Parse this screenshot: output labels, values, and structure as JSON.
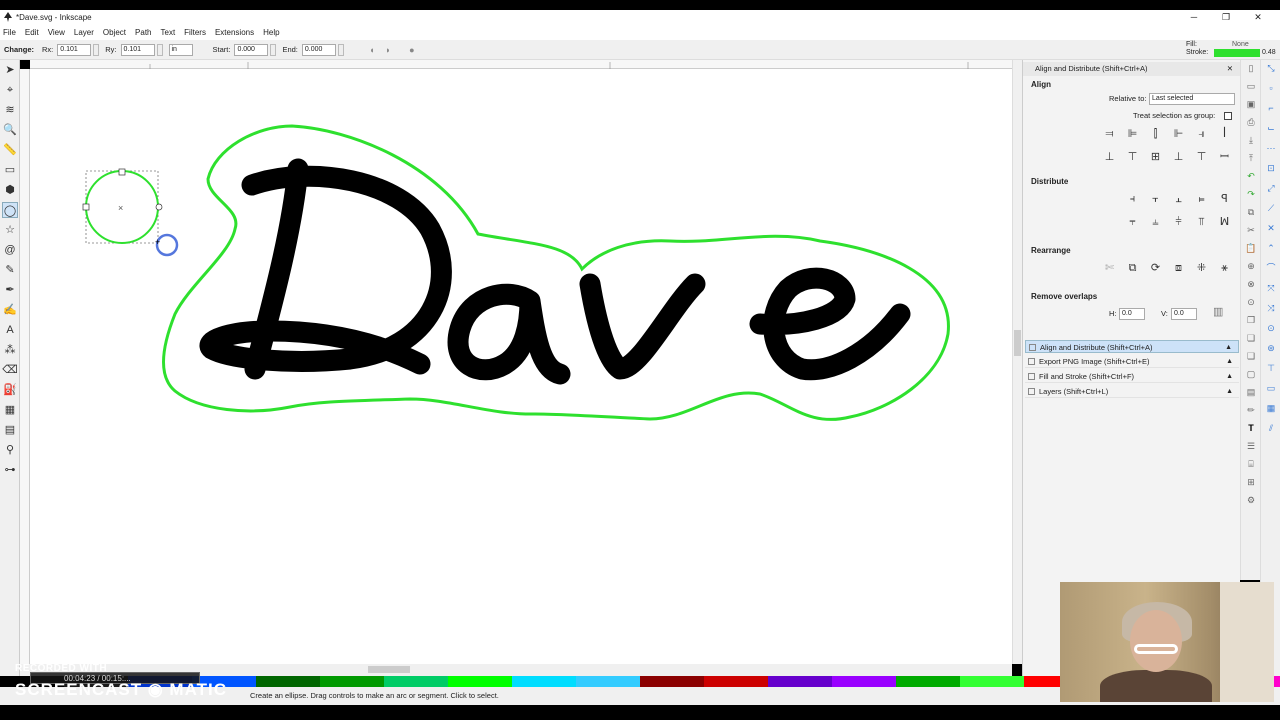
{
  "window": {
    "title": "*Dave.svg - Inkscape",
    "minimize": "─",
    "maximize": "❐",
    "close": "✕"
  },
  "menu": [
    "File",
    "Edit",
    "View",
    "Layer",
    "Object",
    "Path",
    "Text",
    "Filters",
    "Extensions",
    "Help"
  ],
  "tool_controls": {
    "change_label": "Change:",
    "rx_label": "Rx:",
    "rx_value": "0.101",
    "ry_label": "Ry:",
    "ry_value": "0.101",
    "unit": "in",
    "start_label": "Start:",
    "start_value": "0.000",
    "end_label": "End:",
    "end_value": "0.000"
  },
  "fill_stroke": {
    "fill_label": "Fill:",
    "fill_value": "None",
    "stroke_label": "Stroke:",
    "stroke_width": "0.48",
    "stroke_color": "#2ee02e"
  },
  "tools": [
    "selector-tool",
    "node-tool",
    "tweak-tool",
    "zoom-tool",
    "measure-tool",
    "rect-tool",
    "3dbox-tool",
    "ellipse-tool",
    "star-tool",
    "spiral-tool",
    "pencil-tool",
    "pen-tool",
    "calligraphy-tool",
    "text-tool",
    "spray-tool",
    "eraser-tool",
    "bucket-tool",
    "gradient-tool",
    "mesh-tool",
    "dropper-tool",
    "connector-tool"
  ],
  "tool_glyphs": [
    "➤",
    "⌖",
    "≋",
    "🔍",
    "📏",
    "▭",
    "⬢",
    "◯",
    "☆",
    "@",
    "✎",
    "✒",
    "✍",
    "A",
    "⁂",
    "⌫",
    "⛽",
    "▦",
    "▤",
    "⚲",
    "⊶"
  ],
  "canvas": {
    "text": "Dave",
    "outline_color": "#2ee02e",
    "text_color": "#000000"
  },
  "dock": {
    "header": "Align and Distribute (Shift+Ctrl+A)",
    "align_label": "Align",
    "relative_to_label": "Relative to:",
    "relative_to_value": "Last selected",
    "treat_group_label": "Treat selection as group:",
    "distribute_label": "Distribute",
    "rearrange_label": "Rearrange",
    "remove_overlaps_label": "Remove overlaps",
    "h_label": "H:",
    "h_value": "0.0",
    "v_label": "V:",
    "v_value": "0.0",
    "panels": [
      "Align and Distribute (Shift+Ctrl+A)",
      "Export PNG Image (Shift+Ctrl+E)",
      "Fill and Stroke (Shift+Ctrl+F)",
      "Layers (Shift+Ctrl+L)"
    ]
  },
  "status": {
    "message": "Create an ellipse. Drag controls to make an arc or segment. Click to select."
  },
  "watermark": {
    "recorded_with": "RECORDED WITH",
    "brand": "SCREENCAST ◉ MATIC",
    "time": "00:04:23 / 00:15:..."
  },
  "palette_colors": [
    "#000000",
    "#1a1a1a",
    "#0033cc",
    "#0055ff",
    "#006600",
    "#009900",
    "#00cc66",
    "#00ff00",
    "#00ddff",
    "#33ccff",
    "#8b0000",
    "#cc0000",
    "#6600cc",
    "#9900ff",
    "#00aa00",
    "#33ff33",
    "#ff0000",
    "#ff3300",
    "#ff0066",
    "#ff00cc"
  ]
}
